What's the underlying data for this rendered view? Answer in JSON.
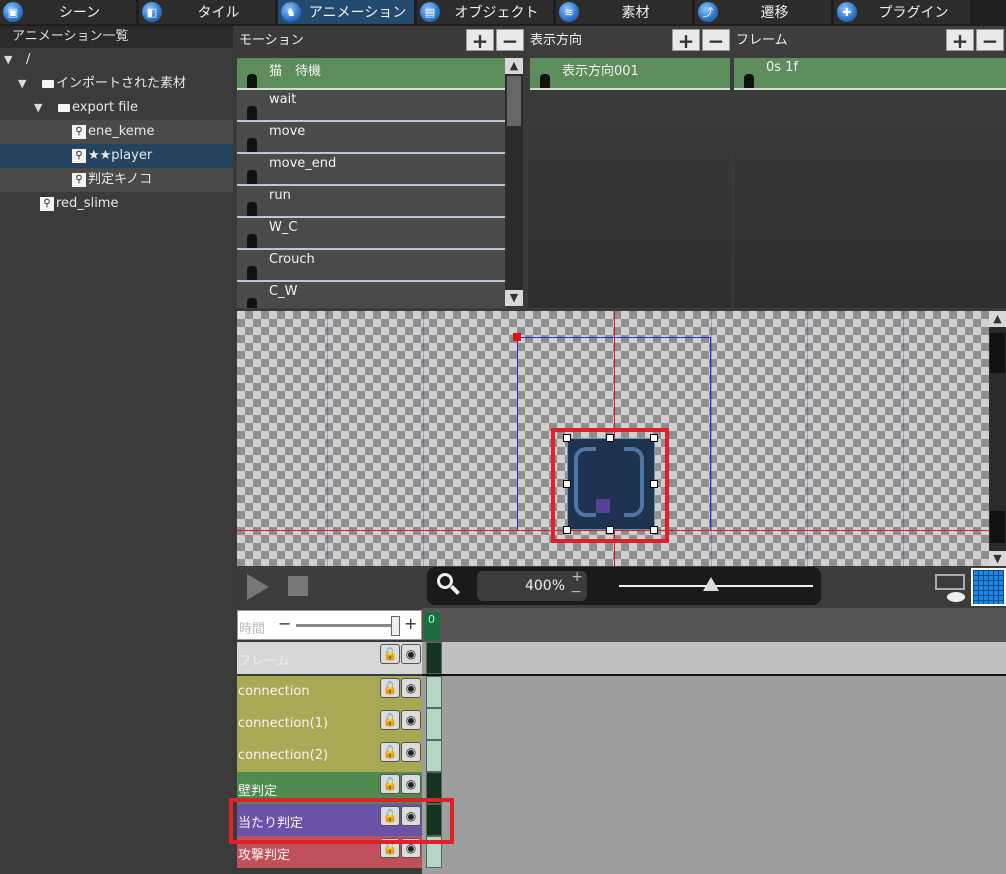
{
  "tabs": [
    {
      "label": "シーン",
      "icon": "scene-icon"
    },
    {
      "label": "タイル",
      "icon": "tile-icon"
    },
    {
      "label": "アニメーション",
      "icon": "animation-icon"
    },
    {
      "label": "オブジェクト",
      "icon": "object-icon"
    },
    {
      "label": "素材",
      "icon": "material-icon"
    },
    {
      "label": "遷移",
      "icon": "transition-icon"
    },
    {
      "label": "プラグイン",
      "icon": "plugin-icon"
    }
  ],
  "tree": {
    "header": "アニメーション一覧",
    "root": "/",
    "imported": "インポートされた素材",
    "export_folder": "export file",
    "items": [
      "ene_keme",
      "★★player",
      "判定キノコ"
    ],
    "other": "red_slime"
  },
  "motion": {
    "title": "モーション",
    "items": [
      "猫　待機",
      "wait",
      "move",
      "move_end",
      "run",
      "W_C",
      "Crouch",
      "C_W"
    ]
  },
  "direction": {
    "title": "表示方向",
    "items": [
      "表示方向001"
    ]
  },
  "frame": {
    "title": "フレーム",
    "items": [
      "0s 1f"
    ]
  },
  "toolbar": {
    "zoom": "400%"
  },
  "timeline": {
    "time_label": "時間",
    "frame_number": "0",
    "layers": [
      {
        "name": "フレーム",
        "color": "#cfcfcf"
      },
      {
        "name": "connection",
        "color": "#a8a855"
      },
      {
        "name": "connection(1)",
        "color": "#a8a855"
      },
      {
        "name": "connection(2)",
        "color": "#a8a855"
      },
      {
        "name": "壁判定",
        "color": "#4f8a4f"
      },
      {
        "name": "当たり判定",
        "color": "#6a52a6"
      },
      {
        "name": "攻撃判定",
        "color": "#c0505a"
      }
    ]
  },
  "colors": {
    "accent_red": "#e0202a",
    "selected_green": "#5d8d5d",
    "tree_selected": "#24435f"
  }
}
